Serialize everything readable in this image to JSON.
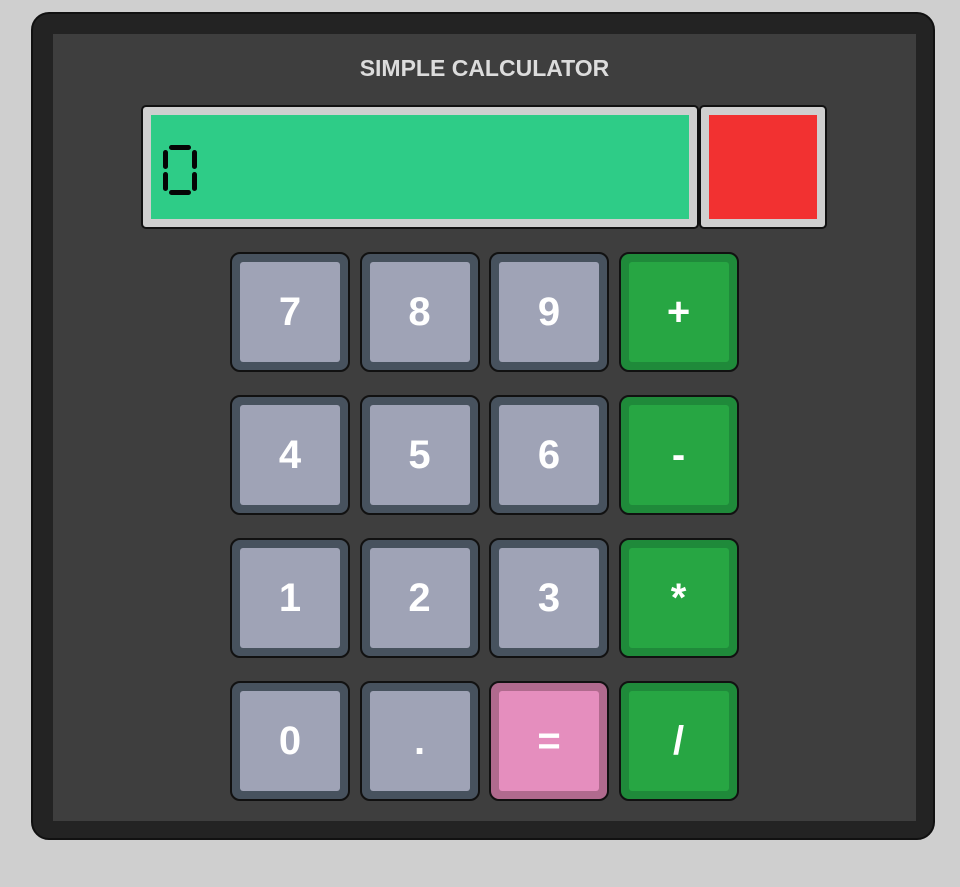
{
  "app": {
    "title": "SIMPLE CALCULATOR"
  },
  "display": {
    "value": "0",
    "screen_color": "#2ecc87",
    "indicator_color": "#f23131"
  },
  "keys": [
    {
      "label": "7",
      "kind": "num"
    },
    {
      "label": "8",
      "kind": "num"
    },
    {
      "label": "9",
      "kind": "num"
    },
    {
      "label": "+",
      "kind": "op"
    },
    {
      "label": "4",
      "kind": "num"
    },
    {
      "label": "5",
      "kind": "num"
    },
    {
      "label": "6",
      "kind": "num"
    },
    {
      "label": "-",
      "kind": "op"
    },
    {
      "label": "1",
      "kind": "num"
    },
    {
      "label": "2",
      "kind": "num"
    },
    {
      "label": "3",
      "kind": "num"
    },
    {
      "label": "*",
      "kind": "op"
    },
    {
      "label": "0",
      "kind": "num"
    },
    {
      "label": ".",
      "kind": "num"
    },
    {
      "label": "=",
      "kind": "eq"
    },
    {
      "label": "/",
      "kind": "op"
    }
  ]
}
